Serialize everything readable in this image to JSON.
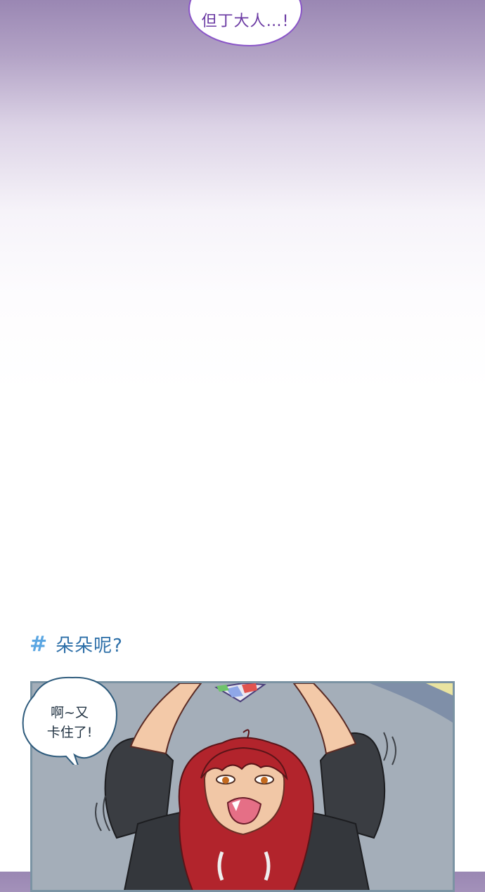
{
  "top_bubble": {
    "text": "但丁大人…!"
  },
  "section": {
    "icon": "hash-icon",
    "title": "朵朵呢?"
  },
  "panel_bubble": {
    "line1": "啊~又",
    "line2": "卡住了!"
  },
  "colors": {
    "accent_blue": "#5aa6e2",
    "heading_blue": "#2d6fa8",
    "bubble_purple": "#8a55c8",
    "panel_border": "#7b93a3",
    "hair_red": "#b2242c"
  },
  "illustration": {
    "subject": "red-haired character in black hoodie reaching upward"
  }
}
